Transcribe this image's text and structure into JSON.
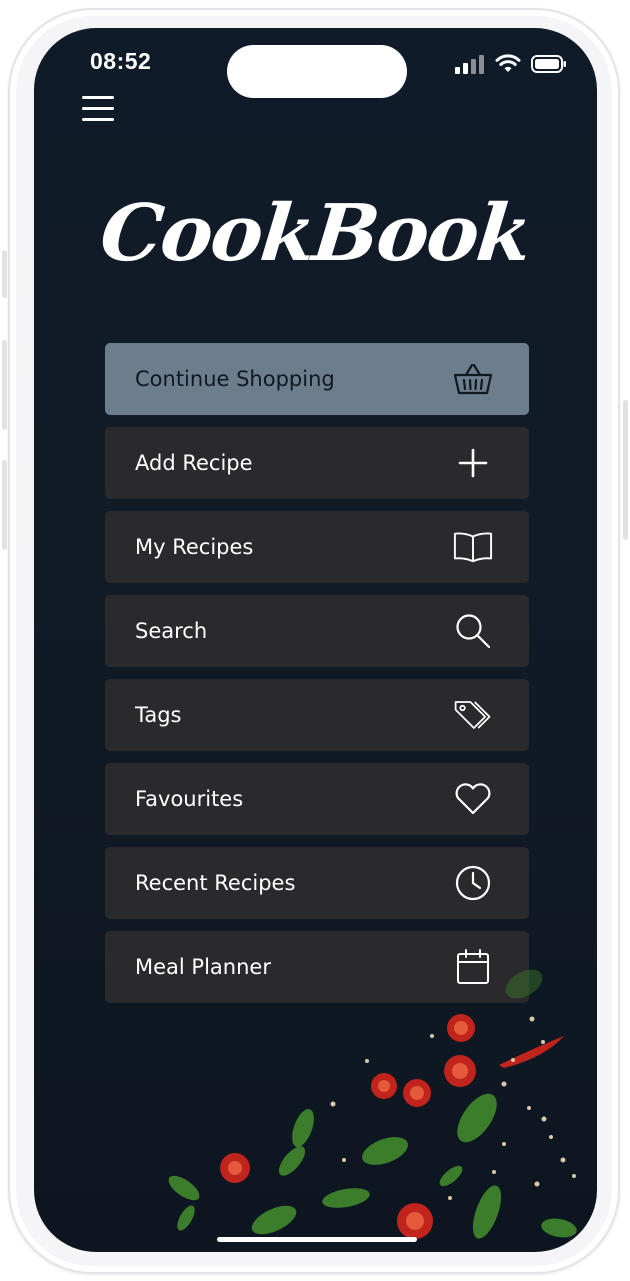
{
  "status_bar": {
    "time": "08:52",
    "icons": [
      "signal-icon",
      "wifi-icon",
      "battery-icon"
    ]
  },
  "app": {
    "logo": "CookBook"
  },
  "menu": {
    "items": [
      {
        "label": "Continue Shopping",
        "icon": "basket-icon",
        "active": true
      },
      {
        "label": "Add Recipe",
        "icon": "plus-icon",
        "active": false
      },
      {
        "label": "My Recipes",
        "icon": "book-icon",
        "active": false
      },
      {
        "label": "Search",
        "icon": "search-icon",
        "active": false
      },
      {
        "label": "Tags",
        "icon": "tags-icon",
        "active": false
      },
      {
        "label": "Favourites",
        "icon": "heart-icon",
        "active": false
      },
      {
        "label": "Recent Recipes",
        "icon": "clock-icon",
        "active": false
      },
      {
        "label": "Meal Planner",
        "icon": "calendar-icon",
        "active": false
      }
    ]
  },
  "colors": {
    "background": "#0f1b28",
    "menu_item": "#2a2a2c",
    "menu_item_active": "#6c7d8e",
    "text": "#ffffff"
  }
}
